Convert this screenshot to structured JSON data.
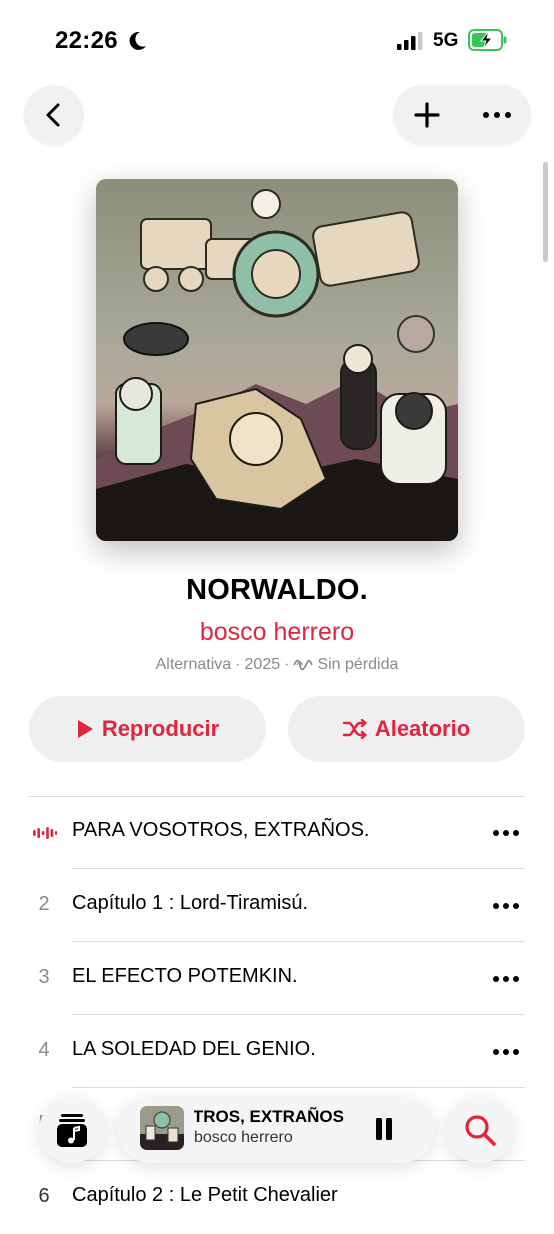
{
  "status": {
    "time": "22:26",
    "network": "5G"
  },
  "album": {
    "title": "NORWALDO.",
    "artist": "bosco herrero",
    "genre": "Alternativa",
    "year": "2025",
    "quality": "Sin pérdida"
  },
  "buttons": {
    "play": "Reproducir",
    "shuffle": "Aleatorio"
  },
  "tracks": [
    {
      "num": "",
      "title": "PARA VOSOTROS, EXTRAÑOS.",
      "playing": true
    },
    {
      "num": "2",
      "title": "Capítulo 1 : Lord-Tiramisú."
    },
    {
      "num": "3",
      "title": "EL EFECTO POTEMKIN."
    },
    {
      "num": "4",
      "title": "LA SOLEDAD DEL GENIO."
    },
    {
      "num": "5",
      "title": ""
    },
    {
      "num": "6",
      "title": "Capítulo 2 : Le Petit Chevalier"
    }
  ],
  "mini_player": {
    "title": "PARA VOSOTROS, EXTRAÑOS.",
    "artist": "bosco herrero"
  },
  "colors": {
    "accent": "#e0253d",
    "secondary": "#8a8a8e",
    "button_bg": "#efeff1"
  },
  "icons": [
    "moon-icon",
    "signal-icon",
    "battery-icon",
    "back-icon",
    "plus-icon",
    "more-icon",
    "play-icon",
    "shuffle-icon",
    "lossless-icon",
    "now-playing-icon",
    "library-icon",
    "pause-icon",
    "search-icon"
  ]
}
